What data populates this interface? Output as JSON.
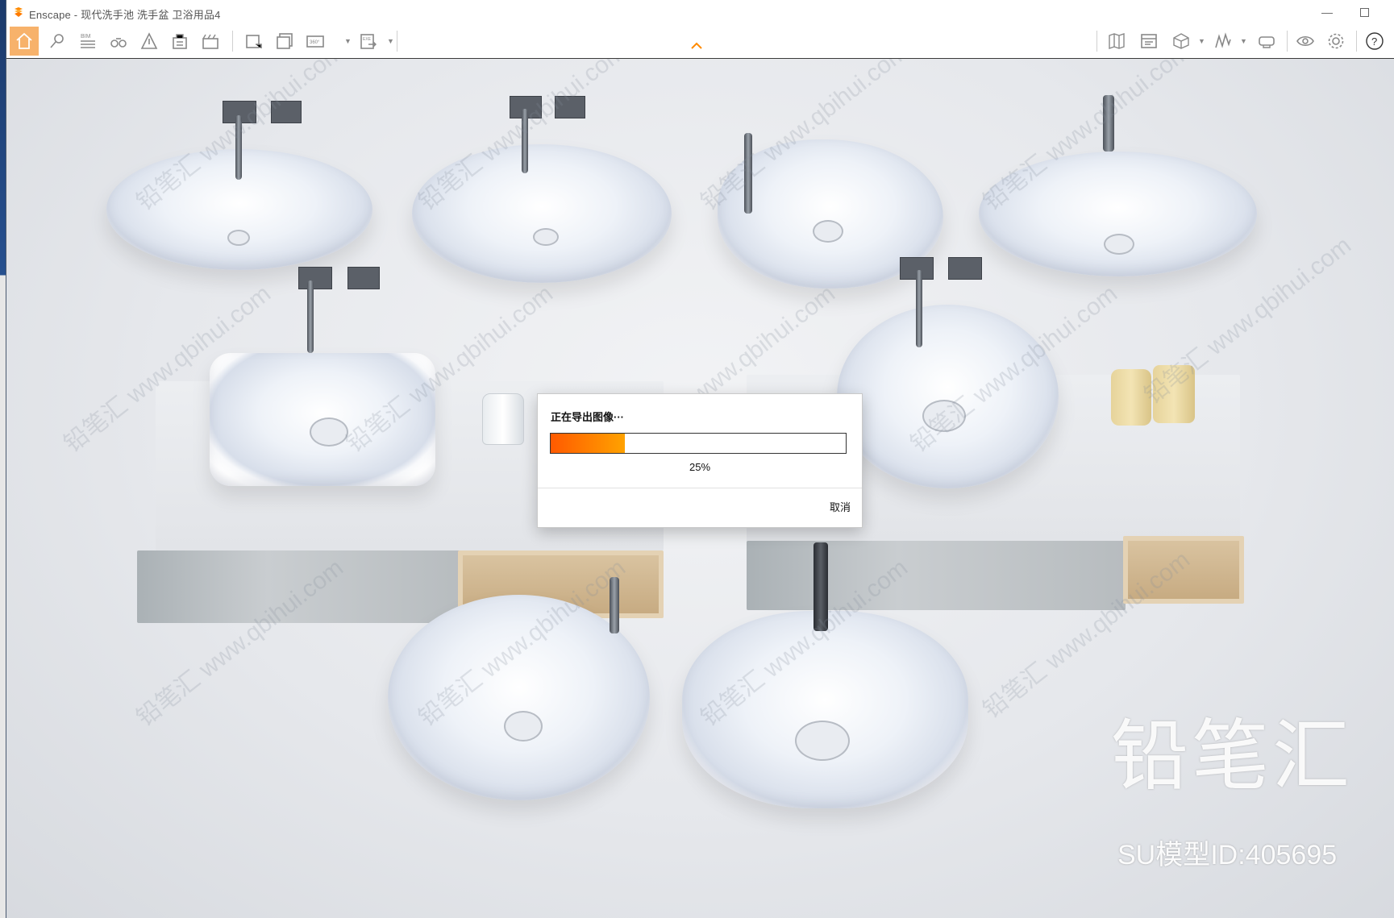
{
  "window": {
    "title": "Enscape - 现代洗手池 洗手盆 卫浴用品4",
    "minimize_icon": "minimize-icon",
    "maximize_icon": "maximize-icon"
  },
  "toolbar": {
    "items": [
      {
        "name": "home-icon",
        "active": true
      },
      {
        "name": "view-management-icon"
      },
      {
        "name": "bim-icon",
        "text": "BIM"
      },
      {
        "name": "binoculars-icon"
      },
      {
        "name": "atmosphere-icon"
      },
      {
        "name": "asset-library-icon"
      },
      {
        "name": "video-editor-icon"
      },
      {
        "name": "screenshot-icon"
      },
      {
        "name": "batch-render-icon"
      },
      {
        "name": "panorama-icon",
        "text": "360°"
      },
      {
        "name": "export-exe-icon",
        "text": "EXE"
      }
    ],
    "right_items": [
      {
        "name": "map-icon"
      },
      {
        "name": "material-editor-icon"
      },
      {
        "name": "cube-view-icon"
      },
      {
        "name": "chart-icon"
      },
      {
        "name": "vr-headset-icon"
      },
      {
        "name": "eye-icon"
      },
      {
        "name": "settings-gear-icon"
      },
      {
        "name": "help-icon",
        "text": "?"
      }
    ],
    "accent_color": "#f7b26b",
    "collapse_arrow_color": "#ff8a00"
  },
  "dialog": {
    "title": "正在导出图像···",
    "progress_percent": 25,
    "progress_label": "25%",
    "cancel_label": "取消"
  },
  "watermark": {
    "logo_text": "铅笔汇",
    "model_id": "SU模型ID:405695",
    "tile_text": "铅笔汇 www.qbihui.com"
  }
}
